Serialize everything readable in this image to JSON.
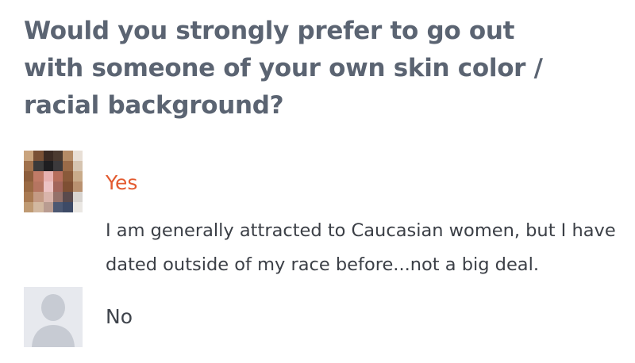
{
  "question": {
    "text": "Would you strongly prefer to go out with someone of your own skin color / racial background?"
  },
  "answers": [
    {
      "label": "Yes",
      "avatar": "pixelated-profile-photo",
      "comment": "I am generally attracted to Caucasian women, but I have dated outside of my race before...not a big deal.",
      "label_color": "#e35a2f"
    },
    {
      "label": "No",
      "avatar": "default-user-icon",
      "label_color": "#3f444c"
    }
  ],
  "colors": {
    "heading": "#5b6472",
    "body_text": "#3b3f46",
    "placeholder_bg": "#e7e9ee",
    "placeholder_icon": "#c7cbd3"
  }
}
